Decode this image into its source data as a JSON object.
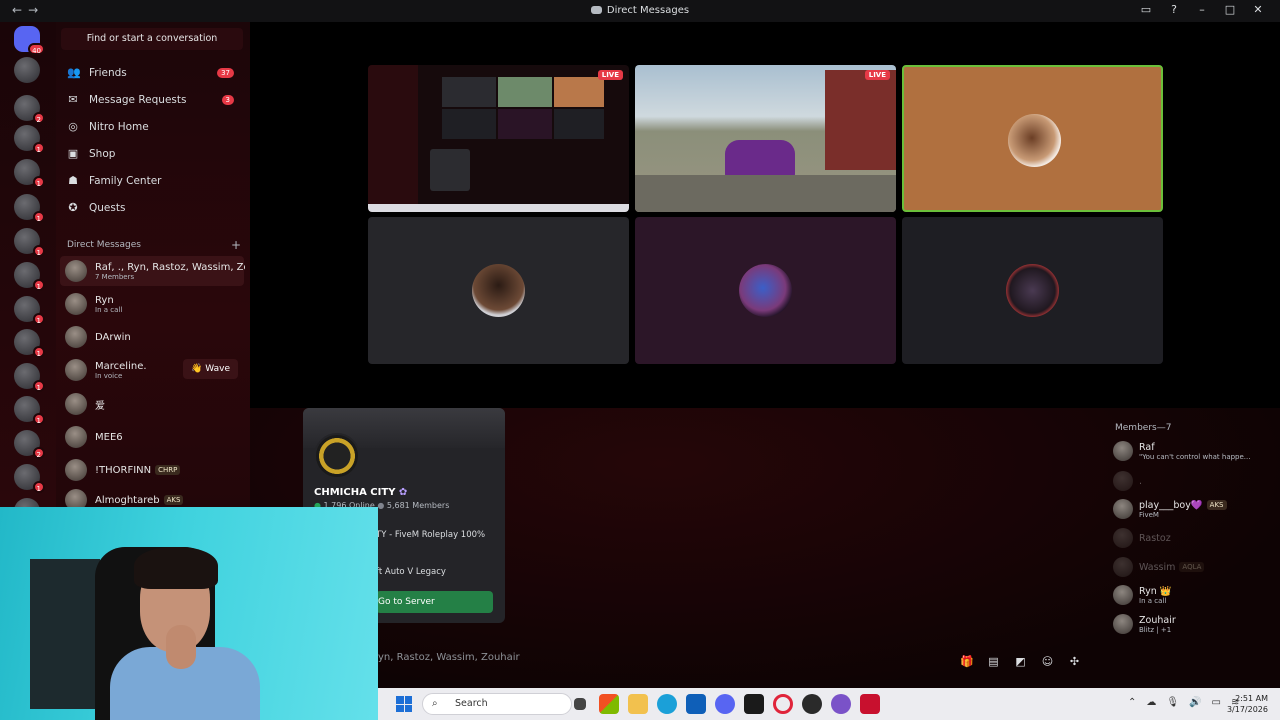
{
  "window": {
    "title": "Direct Messages",
    "back": "←",
    "forward": "→"
  },
  "servers": [
    {
      "badge": "40"
    },
    {
      "badge": ""
    },
    {
      "badge": "2"
    },
    {
      "badge": "1"
    },
    {
      "badge": "1"
    },
    {
      "badge": "1"
    },
    {
      "badge": "1"
    },
    {
      "badge": "1"
    },
    {
      "badge": "1"
    },
    {
      "badge": "1"
    },
    {
      "badge": "1"
    },
    {
      "badge": "1"
    },
    {
      "badge": "2"
    },
    {
      "badge": "1"
    },
    {
      "badge": "2"
    },
    {
      "badge": ""
    }
  ],
  "sidebar": {
    "search_label": "Find or start a conversation",
    "nav": [
      {
        "label": "Friends",
        "icon": "👥",
        "count": "37"
      },
      {
        "label": "Message Requests",
        "icon": "✉",
        "count": "3"
      },
      {
        "label": "Nitro Home",
        "icon": "◎",
        "count": ""
      },
      {
        "label": "Shop",
        "icon": "▣",
        "count": ""
      },
      {
        "label": "Family Center",
        "icon": "☗",
        "count": ""
      },
      {
        "label": "Quests",
        "icon": "✪",
        "count": ""
      }
    ],
    "dm_header": "Direct Messages",
    "dm_add": "+",
    "dms": [
      {
        "name": "Raf, ., Ryn, Rastoz, Wassim, Zo...",
        "sub": "7 Members",
        "tag": ""
      },
      {
        "name": "Ryn",
        "sub": "In a call",
        "tag": ""
      },
      {
        "name": "DArwin",
        "sub": "",
        "tag": ""
      },
      {
        "name": "Marceline.",
        "sub": "In voice",
        "tag": ""
      },
      {
        "name": "爱",
        "sub": "",
        "tag": ""
      },
      {
        "name": "MEE6",
        "sub": "",
        "tag": ""
      },
      {
        "name": "!THORFINN",
        "sub": "",
        "tag": "CHRP"
      },
      {
        "name": "Almoghtareb",
        "sub": "",
        "tag": "AKS"
      }
    ],
    "wave_label": "👋 Wave"
  },
  "stage": {
    "live_label": "LIVE"
  },
  "server_card": {
    "name": "CHMICHA CITY",
    "online": "1,796 Online",
    "members": "5,681 Members",
    "description": "TY - FiveM Roleplay 100%",
    "game": "ft Auto V Legacy",
    "button": "Go to Server"
  },
  "chat": {
    "placeholder": "yn, Rastoz, Wassim, Zouhair"
  },
  "members": {
    "header": "Members—7",
    "list": [
      {
        "name": "Raf",
        "status": "\"You can't control what happe...",
        "tag": "",
        "dim": false
      },
      {
        "name": ".",
        "status": "",
        "tag": "",
        "dim": true
      },
      {
        "name": "play___boy💜",
        "status": "FiveM",
        "tag": "AKS",
        "dim": false
      },
      {
        "name": "Rastoz",
        "status": "",
        "tag": "",
        "dim": true
      },
      {
        "name": "Wassim",
        "status": "",
        "tag": "AQLA",
        "dim": true
      },
      {
        "name": "Ryn 👑",
        "status": "In a call",
        "tag": "",
        "dim": false
      },
      {
        "name": "Zouhair",
        "status": "Blitz | +1",
        "tag": "",
        "dim": false
      }
    ]
  },
  "taskbar": {
    "search_placeholder": "Search",
    "time": "2:51 AM",
    "date": "3/17/2026"
  },
  "colors": {
    "accent": "#5865f2",
    "danger": "#e63946",
    "go": "#248046",
    "stream_border": "#6bbf3a"
  }
}
